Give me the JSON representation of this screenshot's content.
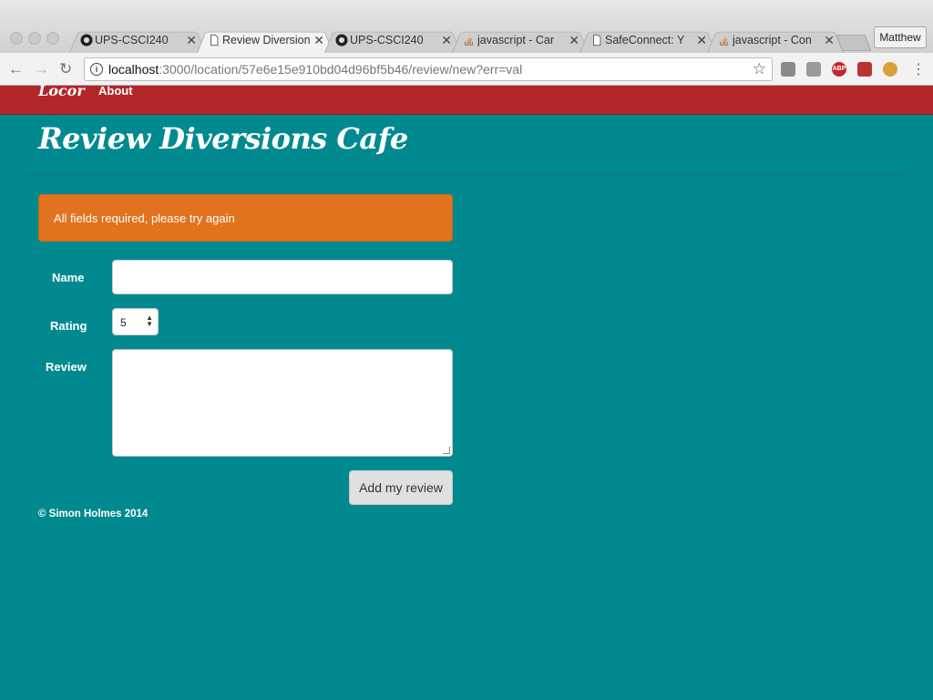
{
  "browser": {
    "tabs": [
      {
        "title": "UPS-CSCI240",
        "icon": "github-icon"
      },
      {
        "title": "Review Diversions Cafe",
        "icon": "page-icon"
      },
      {
        "title": "UPS-CSCI240",
        "icon": "github-icon"
      },
      {
        "title": "javascript - Car",
        "icon": "stackoverflow-icon"
      },
      {
        "title": "SafeConnect: Y",
        "icon": "page-icon"
      },
      {
        "title": "javascript - Con",
        "icon": "stackoverflow-icon"
      }
    ],
    "profile": "Matthew",
    "url_host": "localhost",
    "url_rest": ":3000/location/57e6e15e910bd04d96bf5b46/review/new?err=val",
    "extensions": [
      "drive-icon",
      "dropbox-icon",
      "abp-icon",
      "momentum-icon",
      "owl-icon"
    ],
    "extension_labels": {
      "abp": "ABP"
    }
  },
  "navbar": {
    "brand": "Locor",
    "about": "About"
  },
  "page": {
    "title": "Review Diversions Cafe",
    "alert": "All fields required, please try again"
  },
  "form": {
    "name_label": "Name",
    "name_value": "",
    "rating_label": "Rating",
    "rating_value": "5",
    "review_label": "Review",
    "review_value": "",
    "submit_label": "Add my review"
  },
  "footer": {
    "text": "© Simon Holmes 2014"
  },
  "colors": {
    "background": "#008a90",
    "navbar": "#b2262a",
    "alert": "#e2731e"
  }
}
